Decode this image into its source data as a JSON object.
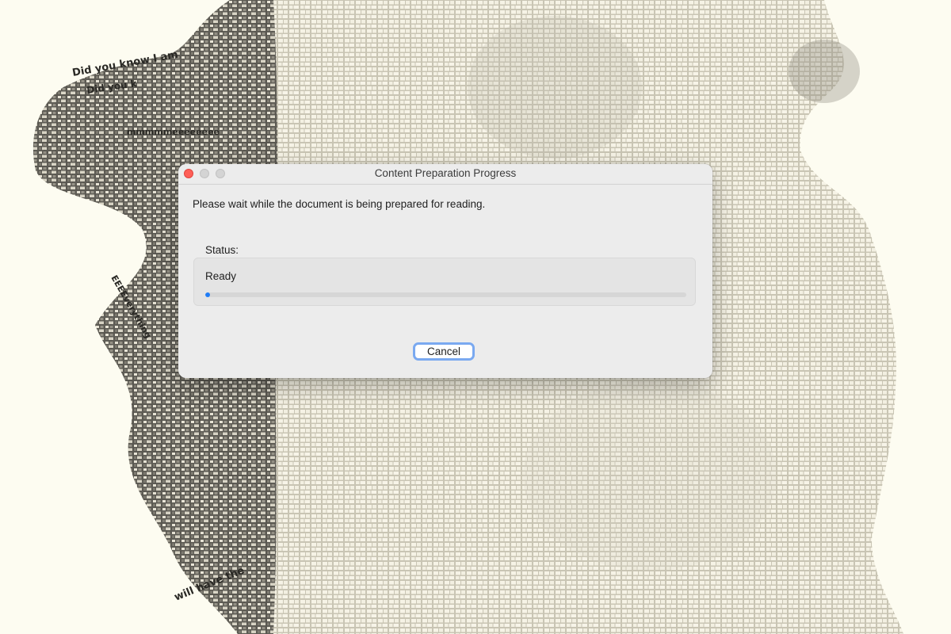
{
  "window": {
    "title": "Content Preparation Progress"
  },
  "dialog": {
    "message": "Please wait while the document is being prepared for reading.",
    "status_label": "Status:",
    "status_value": "Ready",
    "progress": 0.01,
    "cancel_label": "Cancel"
  },
  "background": {
    "visible_text": [
      "Did you know I am",
      "Did you k",
      "mmmmmeeeeeeee",
      "EEEEverything",
      "will have the"
    ]
  },
  "colors": {
    "accent": "#1f7cf6",
    "close_button": "#fe5f57",
    "focus_ring": "#7aa9f0",
    "backdrop": "#fdfcf1"
  }
}
